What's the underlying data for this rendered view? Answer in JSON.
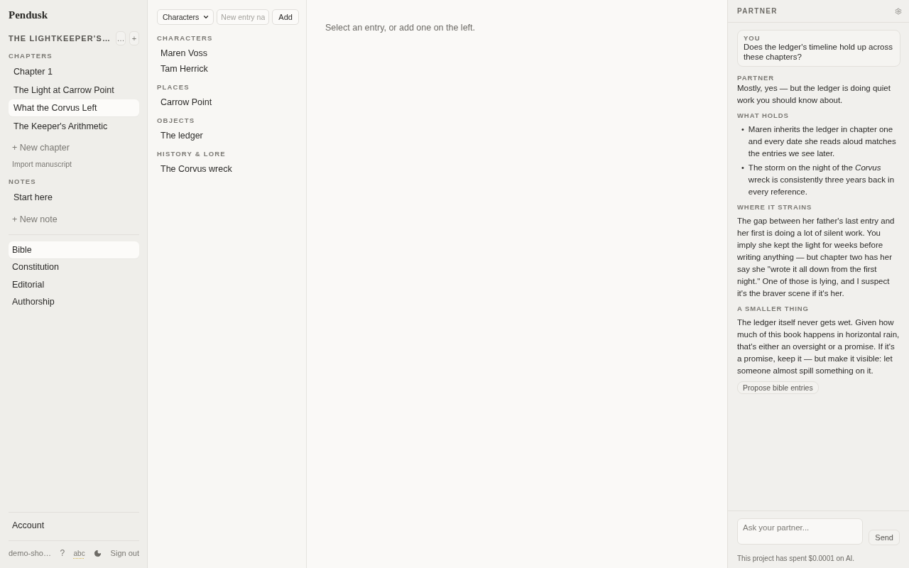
{
  "sidebar": {
    "app_name": "Pendusk",
    "project": {
      "title": "THE LIGHTKEEPER'S…",
      "more_button": "…",
      "add_button": "+"
    },
    "chapters_heading": "CHAPTERS",
    "chapters": [
      {
        "label": "Chapter 1",
        "selected": false
      },
      {
        "label": "The Light at Carrow Point",
        "selected": false
      },
      {
        "label": "What the Corvus Left",
        "selected": true
      },
      {
        "label": "The Keeper's Arithmetic",
        "selected": false
      }
    ],
    "new_chapter": "+ New chapter",
    "import_manuscript": "Import manuscript",
    "notes_heading": "NOTES",
    "notes": [
      {
        "label": "Start here",
        "selected": false
      }
    ],
    "new_note": "+ New note",
    "nav": [
      {
        "label": "Bible",
        "selected": true
      },
      {
        "label": "Constitution",
        "selected": false
      },
      {
        "label": "Editorial",
        "selected": false
      },
      {
        "label": "Authorship",
        "selected": false
      }
    ],
    "account": "Account",
    "footer": {
      "user": "demo-sho…",
      "help": "?",
      "spellcheck": "abc",
      "sign_out": "Sign out"
    }
  },
  "bible": {
    "type_select": "Characters",
    "new_entry": {
      "placeholder": "New entry na"
    },
    "add_button": "Add",
    "groups": [
      {
        "heading": "CHARACTERS",
        "entries": [
          {
            "label": "Maren Voss",
            "selected": false
          },
          {
            "label": "Tam Herrick",
            "selected": false
          }
        ]
      },
      {
        "heading": "PLACES",
        "entries": [
          {
            "label": "Carrow Point",
            "selected": false
          }
        ]
      },
      {
        "heading": "OBJECTS",
        "entries": [
          {
            "label": "The ledger",
            "selected": false
          }
        ]
      },
      {
        "heading": "HISTORY & LORE",
        "entries": [
          {
            "label": "The Corvus wreck",
            "selected": false
          }
        ]
      }
    ]
  },
  "main": {
    "empty_message": "Select an entry, or add one on the left."
  },
  "partner": {
    "title": "PARTNER",
    "messages": [
      {
        "kind": "user",
        "author": "YOU",
        "text": "Does the ledger's timeline hold up across these chapters?"
      },
      {
        "kind": "reply",
        "author": "PARTNER",
        "blocks": [
          {
            "kind": "paragraph",
            "text": "Mostly, yes — but the ledger is doing quiet work you should know about."
          },
          {
            "kind": "heading",
            "text": "WHAT HOLDS"
          },
          {
            "kind": "list",
            "items": [
              {
                "marker": "•",
                "text": "Maren inherits the ledger in chapter one and every date she reads aloud matches the entries we see later."
              },
              {
                "marker": "•",
                "text": "The storm on the night of the *Corvus* wreck is consistently three years back in every reference."
              }
            ]
          },
          {
            "kind": "heading",
            "text": "WHERE IT STRAINS"
          },
          {
            "kind": "paragraph",
            "text": "The gap between her father's last entry and her first is doing a lot of silent work. You imply she kept the light for weeks before writing anything — but chapter two has her say she \"wrote it all down from the first night.\" One of those is lying, and I suspect it's the braver scene if it's her."
          },
          {
            "kind": "heading",
            "text": "A SMALLER THING"
          },
          {
            "kind": "paragraph",
            "text": "The ledger itself never gets wet. Given how much of this book happens in horizontal rain, that's either an oversight or a promise. If it's a promise, keep it — but make it visible: let someone almost spill something on it."
          }
        ]
      }
    ],
    "action_button": "Propose bible entries",
    "input": {
      "placeholder": "Ask your partner..."
    },
    "send_button": "Send",
    "cost_note": "This project has spent $0.0001 on AI."
  }
}
